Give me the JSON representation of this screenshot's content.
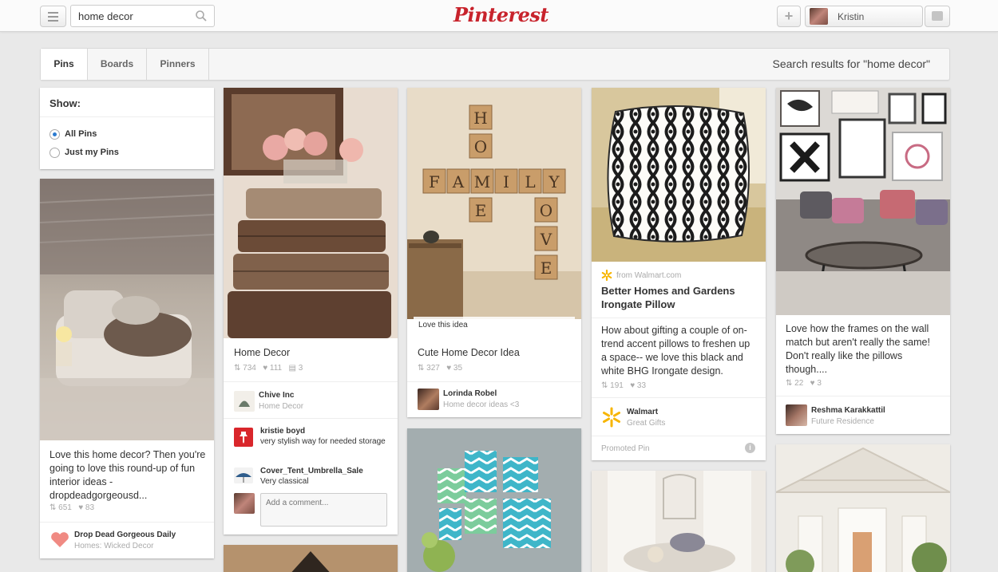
{
  "header": {
    "search_value": "home decor",
    "logo_text": "Pinterest",
    "add_label": "+",
    "user_name": "Kristin"
  },
  "subnav": {
    "tabs": [
      {
        "label": "Pins"
      },
      {
        "label": "Boards"
      },
      {
        "label": "Pinners"
      }
    ],
    "results_text": "Search results for \"home decor\""
  },
  "show_filter": {
    "title": "Show:",
    "options": [
      {
        "label": "All Pins",
        "selected": true
      },
      {
        "label": "Just my Pins",
        "selected": false
      }
    ]
  },
  "pins": [
    {
      "description": "Love this home decor? Then you're going to love this round-up of fun interior ideas - dropdeadgorgeousd...",
      "repins": "651",
      "likes": "83",
      "pinner": "Drop Dead Gorgeous Daily",
      "board": "Homes: Wicked Decor"
    },
    {
      "description": "Home Decor",
      "repins": "734",
      "likes": "111",
      "comments": "3",
      "pinner": "Chive Inc",
      "board": "Home Decor",
      "comment_list": [
        {
          "name": "kristie boyd",
          "text": "very stylish way for needed storage"
        },
        {
          "name": "Cover_Tent_Umbrella_Sale",
          "text": "Very classical"
        }
      ],
      "comment_placeholder": "Add a comment..."
    },
    {
      "overlay": "Love this idea",
      "description": "Cute Home Decor Idea",
      "repins": "327",
      "likes": "35",
      "pinner": "Lorinda Robel",
      "board": "Home decor ideas <3",
      "tiles_row": [
        "F",
        "A",
        "M",
        "I",
        "L",
        "Y"
      ],
      "tiles_col1": [
        "H",
        "O",
        "E"
      ],
      "tiles_col2": [
        "O",
        "V",
        "E"
      ]
    },
    {
      "source": "from Walmart.com",
      "title": "Better Homes and Gardens Irongate Pillow",
      "description": "How about gifting a couple of on-trend accent pillows to freshen up a space-- we love this black and white BHG Irongate design.",
      "repins": "191",
      "likes": "33",
      "pinner": "Walmart",
      "board": "Great Gifts",
      "promoted": "Promoted Pin"
    },
    {
      "description": "Love how the frames on the wall match but aren't really the same! Don't really like the pillows though....",
      "repins": "22",
      "likes": "3",
      "pinner": "Reshma Karakkattil",
      "board": "Future Residence"
    }
  ],
  "colors": {
    "brand_red": "#c8232c",
    "background": "#e9e9e9",
    "walmart_yellow": "#f7b500"
  }
}
